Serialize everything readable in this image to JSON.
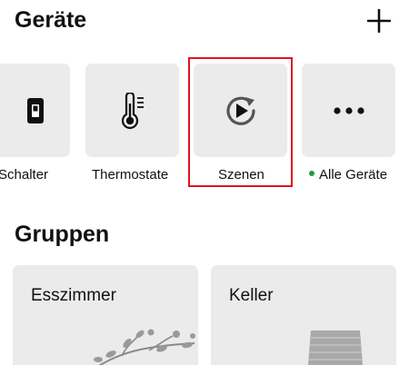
{
  "devices": {
    "title": "Geräte",
    "add_icon": "plus-icon",
    "tiles": [
      {
        "label": "Schalter",
        "icon": "switch-icon"
      },
      {
        "label": "Thermostate",
        "icon": "thermometer-icon"
      },
      {
        "label": "Szenen",
        "icon": "scene-play-icon"
      },
      {
        "label": "Alle Geräte",
        "icon": "more-dots-icon",
        "status_color": "#1e9e3e"
      }
    ]
  },
  "groups": {
    "title": "Gruppen",
    "cards": [
      {
        "name": "Esszimmer",
        "icon": "plant-illustration"
      },
      {
        "name": "Keller",
        "icon": "basement-stairs-illustration"
      }
    ]
  },
  "colors": {
    "tile_bg": "#ebebeb",
    "highlight": "#e0141e",
    "status_dot": "#1e9e3e",
    "text": "#0f1111"
  }
}
